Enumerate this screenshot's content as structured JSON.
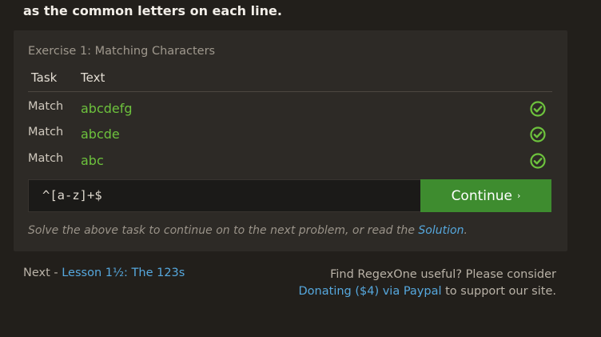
{
  "intro_text": "as the common letters on each line.",
  "exercise": {
    "title": "Exercise 1: Matching Characters",
    "columns": {
      "task": "Task",
      "text": "Text"
    },
    "rows": [
      {
        "task": "Match",
        "text": "abcdefg",
        "status": "check-icon"
      },
      {
        "task": "Match",
        "text": "abcde",
        "status": "check-icon"
      },
      {
        "task": "Match",
        "text": "abc",
        "status": "check-icon"
      }
    ],
    "answer_value": "^[a-z]+$",
    "continue_label": "Continue",
    "continue_chevron": "›",
    "hint_prefix": "Solve the above task to continue on to the next problem, or read the ",
    "hint_link": "Solution",
    "hint_suffix": "."
  },
  "footer": {
    "next_prefix": "Next - ",
    "next_link": "Lesson 1½: The 123s",
    "promo_line1": "Find RegexOne useful? Please consider",
    "promo_link": "Donating ($4) via Paypal",
    "promo_suffix": " to support our site."
  },
  "colors": {
    "background": "#221f1b",
    "panel": "#2d2a26",
    "match_green": "#6dc23d",
    "button_green": "#3e8c2f",
    "link_blue": "#56a8de"
  }
}
